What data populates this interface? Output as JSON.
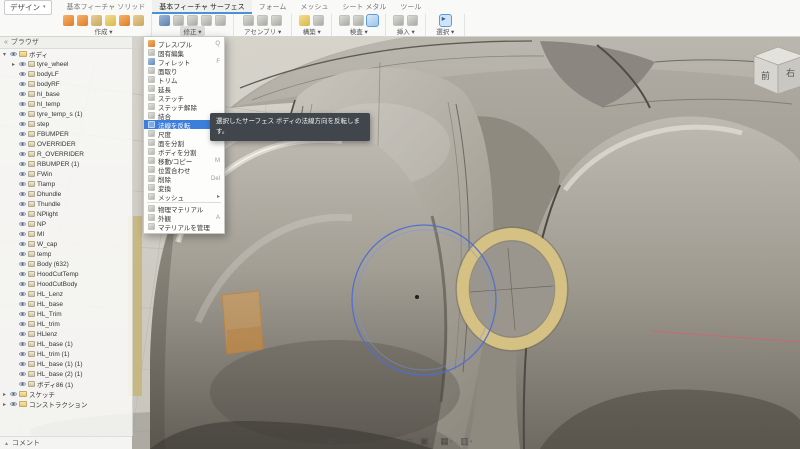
{
  "toolbar": {
    "design_menu": {
      "label": "デザイン"
    },
    "tabs": [
      {
        "label": "基本フィーチャ ソリッド"
      },
      {
        "label": "基本フィーチャ サーフェス",
        "active": true
      },
      {
        "label": "フォーム"
      },
      {
        "label": "メッシュ"
      },
      {
        "label": "シート メタル"
      },
      {
        "label": "ツール"
      }
    ],
    "groups": [
      {
        "label": "作成",
        "icons": [
          {
            "name": "extrude-icon",
            "c": "orange"
          },
          {
            "name": "revolve-icon",
            "c": "orange"
          },
          {
            "name": "sweep-icon",
            "c": "tan"
          },
          {
            "name": "loft-icon",
            "c": "yellow"
          },
          {
            "name": "patch-icon",
            "c": "orange"
          },
          {
            "name": "offset-icon",
            "c": "tan"
          }
        ]
      },
      {
        "label": "修正",
        "open": true,
        "icons": [
          {
            "name": "press-pull-icon",
            "c": "blue"
          },
          {
            "name": "fillet-icon",
            "c": "grey"
          },
          {
            "name": "trim-icon",
            "c": "grey"
          },
          {
            "name": "extend-icon",
            "c": "grey"
          },
          {
            "name": "stitch-icon",
            "c": "grey"
          }
        ]
      },
      {
        "label": "アセンブリ",
        "icons": [
          {
            "name": "new-component-icon",
            "c": "grey"
          },
          {
            "name": "joint-icon",
            "c": "grey"
          },
          {
            "name": "rigid-group-icon",
            "c": "grey"
          }
        ]
      },
      {
        "label": "構築",
        "icons": [
          {
            "name": "construction-plane-icon",
            "c": "yellow"
          },
          {
            "name": "construction-axis-icon",
            "c": "grey"
          }
        ]
      },
      {
        "label": "検査",
        "icons": [
          {
            "name": "measure-icon",
            "c": "grey"
          },
          {
            "name": "section-analysis-icon",
            "c": "grey"
          },
          {
            "name": "display-analysis-icon",
            "c": "blue-active"
          }
        ]
      },
      {
        "label": "挿入",
        "icons": [
          {
            "name": "insert-mesh-icon",
            "c": "grey"
          },
          {
            "name": "insert-canvas-icon",
            "c": "grey"
          }
        ]
      },
      {
        "label": "選択",
        "icons": [
          {
            "name": "select-cursor-icon",
            "c": "cursor"
          }
        ]
      }
    ]
  },
  "browser": {
    "title": "ブラウザ",
    "sections": [
      {
        "label": "ボディ",
        "expanded": true,
        "items": [
          {
            "label": "tyre_wheel",
            "expandable": true
          },
          {
            "label": "bodyLF"
          },
          {
            "label": "bodyRF"
          },
          {
            "label": "hl_base"
          },
          {
            "label": "hl_temp"
          },
          {
            "label": "tyre_temp_s (1)"
          },
          {
            "label": "step"
          },
          {
            "label": "FBUMPER"
          },
          {
            "label": "OVERRIDER"
          },
          {
            "label": "R_OVERRIDER"
          },
          {
            "label": "RBUMPER (1)"
          },
          {
            "label": "FWin"
          },
          {
            "label": "Tlamp"
          },
          {
            "label": "Dhundle"
          },
          {
            "label": "Thundle"
          },
          {
            "label": "NPlight"
          },
          {
            "label": "NP"
          },
          {
            "label": "MI"
          },
          {
            "label": "W_cap"
          },
          {
            "label": "temp"
          },
          {
            "label": "Body (632)"
          },
          {
            "label": "HoodCutTemp"
          },
          {
            "label": "HoodCutBody"
          },
          {
            "label": "HL_Lenz"
          },
          {
            "label": "HL_base"
          },
          {
            "label": "HL_Trim"
          },
          {
            "label": "HL_trim"
          },
          {
            "label": "HLlenz"
          },
          {
            "label": "HL_base (1)"
          },
          {
            "label": "HL_trim (1)"
          },
          {
            "label": "HL_base (1) (1)"
          },
          {
            "label": "HL_base (2) (1)"
          },
          {
            "label": "ボディ86 (1)"
          }
        ]
      },
      {
        "label": "スケッチ",
        "expanded": false,
        "items": []
      },
      {
        "label": "コンストラクション",
        "expanded": false,
        "items": []
      }
    ]
  },
  "modify_menu": {
    "items": [
      {
        "label": "プレス/プル",
        "shortcut": "Q",
        "icon": "orange",
        "icon_name": "press-pull-icon"
      },
      {
        "label": "固有編集",
        "icon": "grey",
        "icon_name": "direct-edit-icon"
      },
      {
        "label": "フィレット",
        "shortcut": "F",
        "icon": "blue",
        "icon_name": "fillet-icon"
      },
      {
        "label": "面取り",
        "icon": "grey",
        "icon_name": "chamfer-icon"
      },
      {
        "label": "トリム",
        "icon": "grey",
        "icon_name": "trim-icon"
      },
      {
        "label": "延長",
        "icon": "grey",
        "icon_name": "extend-icon"
      },
      {
        "label": "ステッチ",
        "icon": "grey",
        "icon_name": "stitch-icon"
      },
      {
        "label": "ステッチ解除",
        "icon": "grey",
        "icon_name": "unstitch-icon"
      },
      {
        "label": "結合",
        "icon": "grey",
        "icon_name": "combine-icon"
      },
      {
        "label": "法線を反転",
        "icon": "grey",
        "icon_name": "reverse-normal-icon",
        "highlighted": true
      },
      {
        "label": "尺度",
        "icon": "grey",
        "icon_name": "scale-icon"
      },
      {
        "label": "面を分割",
        "icon": "grey",
        "icon_name": "split-face-icon"
      },
      {
        "label": "ボディを分割",
        "icon": "grey",
        "icon_name": "split-body-icon"
      },
      {
        "label": "移動/コピー",
        "shortcut": "M",
        "icon": "grey",
        "icon_name": "move-copy-icon"
      },
      {
        "label": "位置合わせ",
        "icon": "grey",
        "icon_name": "align-icon"
      },
      {
        "label": "削除",
        "shortcut": "Del",
        "icon": "grey",
        "icon_name": "delete-icon"
      },
      {
        "label": "変換",
        "icon": "grey",
        "icon_name": "convert-icon"
      },
      {
        "label": "メッシュ",
        "icon": "grey",
        "icon_name": "mesh-submenu-icon",
        "submenu": true
      },
      {
        "sep": true
      },
      {
        "label": "物理マテリアル",
        "icon": "grey",
        "icon_name": "physical-material-icon"
      },
      {
        "label": "外観",
        "shortcut": "A",
        "icon": "grey",
        "icon_name": "appearance-icon"
      },
      {
        "label": "マテリアルを管理",
        "icon": "grey",
        "icon_name": "manage-materials-icon"
      }
    ]
  },
  "tooltip": {
    "text": "選択したサーフェス ボディの法線方向を反転します。"
  },
  "viewcube": {
    "front_label": "前",
    "right_label": "右"
  },
  "comment_bar": {
    "label": "コメント"
  },
  "nav_bar": {
    "icons": [
      {
        "name": "pan-icon",
        "glyph": "⇄"
      },
      {
        "name": "orbit-icon",
        "glyph": "↻"
      },
      {
        "name": "look-at-icon",
        "glyph": "◎"
      },
      {
        "name": "zoom-window-icon",
        "glyph": "▭"
      },
      {
        "name": "zoom-icon",
        "glyph": "⊕"
      },
      {
        "name": "fit-icon",
        "glyph": "□"
      },
      {
        "name": "display-settings-icon",
        "glyph": "▣",
        "caret": true
      },
      {
        "name": "grid-settings-icon",
        "glyph": "▦",
        "caret": true
      },
      {
        "name": "viewports-icon",
        "glyph": "▥",
        "caret": true
      }
    ]
  },
  "colors": {
    "accent_blue": "#3d7edb",
    "selection_blue": "#4f6ed0",
    "headlight_tan": "#d4c183",
    "selected_face_orange": "#e49e4a"
  }
}
